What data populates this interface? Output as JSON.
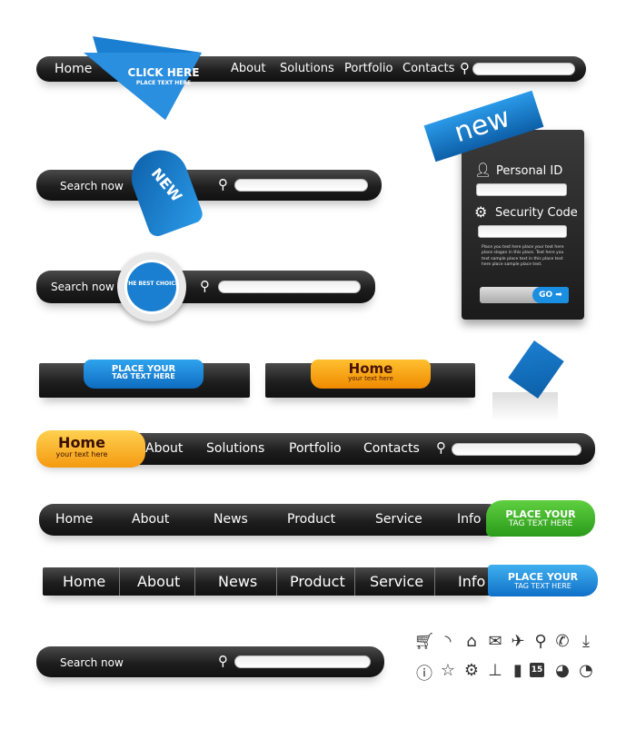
{
  "bar1": {
    "items": [
      "Home",
      "About",
      "Solutions",
      "Portfolio",
      "Contacts"
    ],
    "ribbon_title": "CLICK HERE",
    "ribbon_sub": "PLACE TEXT HERE"
  },
  "search2": {
    "label": "Search now",
    "ribbon": "NEW"
  },
  "search3": {
    "label": "Search now",
    "badge": "THE BEST CHOICE"
  },
  "login": {
    "ribbon": "new",
    "personal_id": "Personal ID",
    "security_code": "Security Code",
    "body": "Place you text here place your text here place slogan in this place. Text here you text sample place text in this place text here place sample place text.",
    "go": "GO"
  },
  "tab1": {
    "line1": "PLACE YOUR",
    "line2": "TAG TEXT HERE"
  },
  "tab2": {
    "title": "Home",
    "sub": "your text here"
  },
  "bar5": {
    "home": "Home",
    "home_sub": "your text here",
    "items": [
      "About",
      "Solutions",
      "Portfolio",
      "Contacts"
    ]
  },
  "bar6": {
    "items": [
      "Home",
      "About",
      "News",
      "Product",
      "Service",
      "Info"
    ],
    "tag1": "PLACE YOUR",
    "tag2": "TAG TEXT HERE"
  },
  "bar7": {
    "items": [
      "Home",
      "About",
      "News",
      "Product",
      "Service",
      "Info"
    ],
    "tag1": "PLACE YOUR",
    "tag2": "TAG TEXT HERE"
  },
  "search8": {
    "label": "Search now"
  },
  "icons": [
    "cart",
    "rss",
    "home",
    "mail",
    "airplane",
    "search",
    "phone",
    "download",
    "info",
    "star",
    "gears",
    "sitemap",
    "trash",
    "calendar",
    "pie-chart",
    "pie-chart-2"
  ],
  "calendar_day": "15",
  "colors": {
    "blue": "#1a7fd0",
    "orange": "#f7a51c",
    "green": "#3fae2a",
    "bar": "#222222"
  }
}
